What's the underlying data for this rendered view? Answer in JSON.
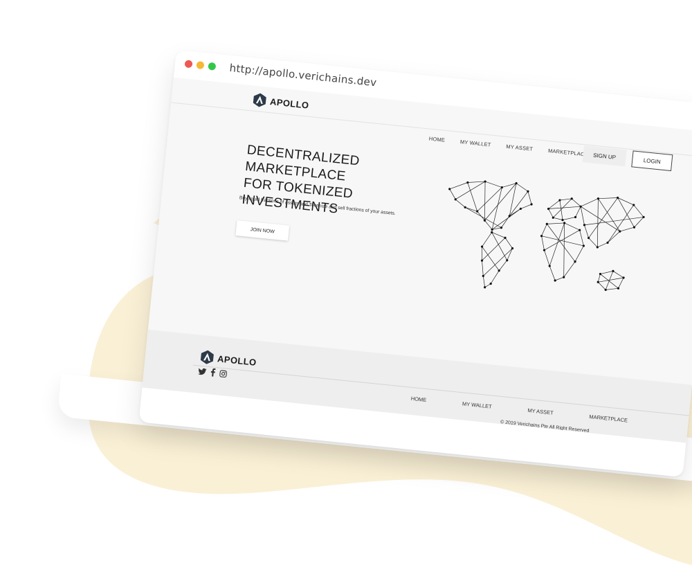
{
  "browser": {
    "url": "http://apollo.verichains.dev",
    "dots": [
      "#ee5a52",
      "#f4b935",
      "#33c748"
    ]
  },
  "brand": {
    "name": "APOLLO"
  },
  "nav": {
    "items": [
      "HOME",
      "MY WALLET",
      "MY ASSET",
      "MARKETPLACE"
    ],
    "signup": "SIGN UP",
    "login": "LOGIN"
  },
  "hero": {
    "headline_line1": "DECENTRALIZED MARKETPLACE",
    "headline_line2": "FOR TOKENIZED INVESTMENTS",
    "subtext": "Buy liquid fractions of assets and Tokenize and sell fractions of your assets.",
    "cta": "JOIN NOW"
  },
  "footer": {
    "brand": "APOLLO",
    "social_icons": [
      "twitter-icon",
      "facebook-icon",
      "instagram-icon"
    ],
    "items": [
      "HOME",
      "MY WALLET",
      "MY ASSET",
      "MARKETPLACE"
    ],
    "copyright": "© 2019 Verichains Pte All Right Reserved"
  },
  "colors": {
    "blob": "#faf0d6",
    "screen_bg": "#f7f7f7",
    "footer_bg": "#eeeeee",
    "text": "#1b1b1b"
  }
}
